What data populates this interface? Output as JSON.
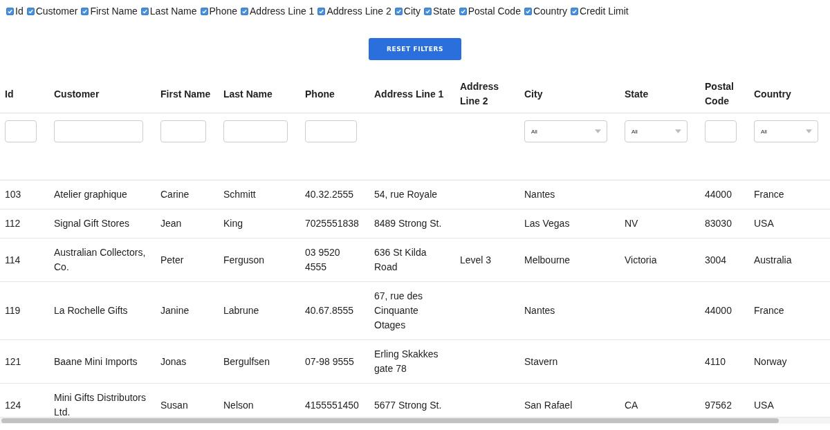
{
  "column_toggles": [
    {
      "label": "Id",
      "checked": true
    },
    {
      "label": "Customer",
      "checked": true
    },
    {
      "label": "First Name",
      "checked": true
    },
    {
      "label": "Last Name",
      "checked": true
    },
    {
      "label": "Phone",
      "checked": true
    },
    {
      "label": "Address Line 1",
      "checked": true
    },
    {
      "label": "Address Line 2",
      "checked": true
    },
    {
      "label": "City",
      "checked": true
    },
    {
      "label": "State",
      "checked": true
    },
    {
      "label": "Postal Code",
      "checked": true
    },
    {
      "label": "Country",
      "checked": true
    },
    {
      "label": "Credit Limit",
      "checked": true
    }
  ],
  "reset_button": "RESET FILTERS",
  "table": {
    "columns": [
      {
        "label": "Id",
        "filter": {
          "kind": "text"
        }
      },
      {
        "label": "Customer",
        "filter": {
          "kind": "text"
        }
      },
      {
        "label": "First Name",
        "filter": {
          "kind": "text"
        }
      },
      {
        "label": "Last Name",
        "filter": {
          "kind": "text"
        }
      },
      {
        "label": "Phone",
        "filter": {
          "kind": "text"
        }
      },
      {
        "label": "Address Line 1",
        "filter": {
          "kind": "none"
        }
      },
      {
        "label": "Address Line 2",
        "filter": {
          "kind": "none"
        }
      },
      {
        "label": "City",
        "filter": {
          "kind": "select",
          "value": "All"
        }
      },
      {
        "label": "State",
        "filter": {
          "kind": "select",
          "value": "All"
        }
      },
      {
        "label": "Postal Code",
        "filter": {
          "kind": "text"
        }
      },
      {
        "label": "Country",
        "filter": {
          "kind": "select",
          "value": "All"
        }
      }
    ],
    "rows": [
      [
        "103",
        "Atelier graphique",
        "Carine",
        "Schmitt",
        "40.32.2555",
        "54, rue Royale",
        "",
        "Nantes",
        "",
        "44000",
        "France"
      ],
      [
        "112",
        "Signal Gift Stores",
        "Jean",
        "King",
        "7025551838",
        "8489 Strong St.",
        "",
        "Las Vegas",
        "NV",
        "83030",
        "USA"
      ],
      [
        "114",
        "Australian Collectors, Co.",
        "Peter",
        "Ferguson",
        "03 9520 4555",
        "636 St Kilda Road",
        "Level 3",
        "Melbourne",
        "Victoria",
        "3004",
        "Australia"
      ],
      [
        "119",
        "La Rochelle Gifts",
        "Janine",
        "Labrune",
        "40.67.8555",
        "67, rue des Cinquante Otages",
        "",
        "Nantes",
        "",
        "44000",
        "France"
      ],
      [
        "121",
        "Baane Mini Imports",
        "Jonas",
        "Bergulfsen",
        "07-98 9555",
        "Erling Skakkes gate 78",
        "",
        "Stavern",
        "",
        "4110",
        "Norway"
      ],
      [
        "124",
        "Mini Gifts Distributors Ltd.",
        "Susan",
        "Nelson",
        "4155551450",
        "5677 Strong St.",
        "",
        "San Rafael",
        "CA",
        "97562",
        "USA"
      ]
    ]
  }
}
